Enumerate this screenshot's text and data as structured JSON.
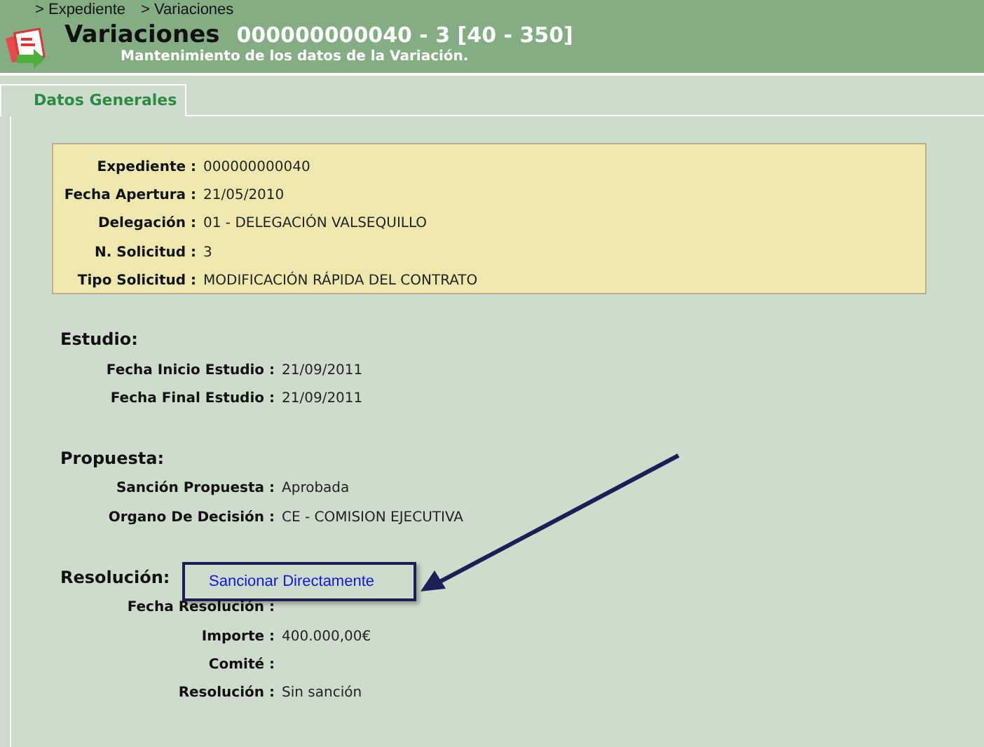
{
  "breadcrumb": [
    "> Expediente",
    "> Variaciones"
  ],
  "header": {
    "title": "Variaciones",
    "code": "000000000040 - 3 [40 - 350]",
    "subtitle": "Mantenimiento de los datos de la Variación."
  },
  "tabs": [
    {
      "label": "Datos Generales",
      "selected": true
    }
  ],
  "summary": [
    {
      "label": "Expediente :",
      "value": "000000000040"
    },
    {
      "label": "Fecha Apertura :",
      "value": "21/05/2010"
    },
    {
      "label": "Delegación :",
      "value": "01 - DELEGACIÓN VALSEQUILLO"
    },
    {
      "label": "N. Solicitud :",
      "value": "3"
    },
    {
      "label": "Tipo Solicitud :",
      "value": "MODIFICACIÓN RÁPIDA DEL CONTRATO"
    }
  ],
  "sections": [
    {
      "title": "Estudio:",
      "fields": [
        {
          "label": "Fecha Inicio Estudio :",
          "value": "21/09/2011"
        },
        {
          "label": "Fecha Final Estudio :",
          "value": "21/09/2011"
        }
      ]
    },
    {
      "title": "Propuesta:",
      "fields": [
        {
          "label": "Sanción Propuesta :",
          "value": "Aprobada"
        },
        {
          "label": "Organo De Decisión :",
          "value": "CE - COMISION EJECUTIVA"
        }
      ]
    },
    {
      "title": "Resolución:",
      "link": "Sancionar Directamente",
      "fields": [
        {
          "label": "Fecha Resolución :"
        },
        {
          "label": "Importe :",
          "value": "400.000,00€"
        },
        {
          "label": "Comité :"
        },
        {
          "label": "Resolución :",
          "value": "Sin sanción"
        }
      ]
    }
  ]
}
